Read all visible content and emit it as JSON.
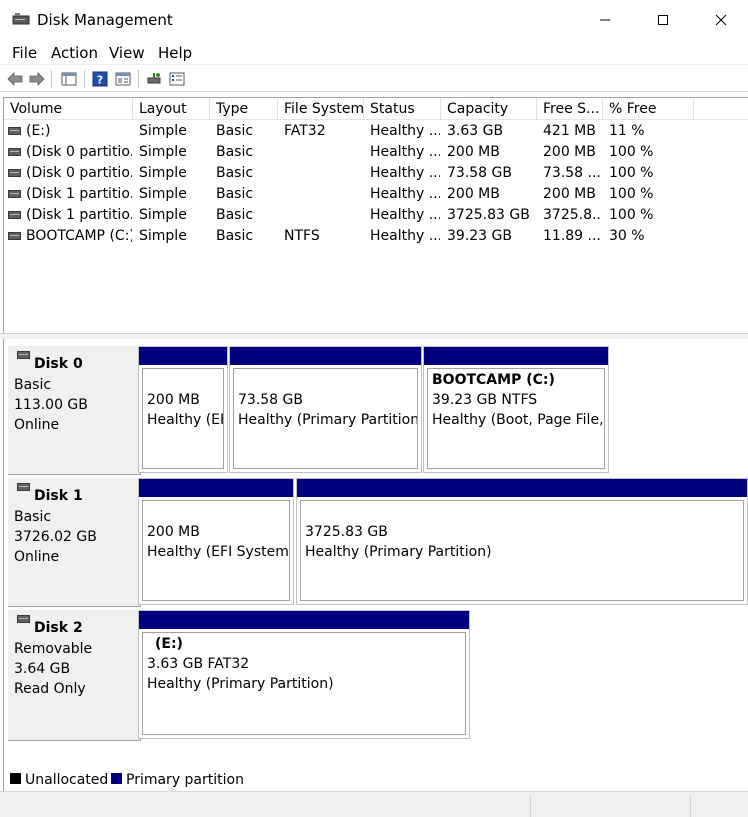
{
  "window": {
    "title": "Disk Management"
  },
  "menu": {
    "file": "File",
    "action": "Action",
    "view": "View",
    "help": "Help"
  },
  "columns": [
    "Volume",
    "Layout",
    "Type",
    "File System",
    "Status",
    "Capacity",
    "Free S...",
    "% Free"
  ],
  "volumes": [
    {
      "volume": "(E:)",
      "layout": "Simple",
      "type": "Basic",
      "fs": "FAT32",
      "status": "Healthy ...",
      "capacity": "3.63 GB",
      "free": "421 MB",
      "pct": "11 %"
    },
    {
      "volume": "(Disk 0 partitio...",
      "layout": "Simple",
      "type": "Basic",
      "fs": "",
      "status": "Healthy ...",
      "capacity": "200 MB",
      "free": "200 MB",
      "pct": "100 %"
    },
    {
      "volume": "(Disk 0 partitio...",
      "layout": "Simple",
      "type": "Basic",
      "fs": "",
      "status": "Healthy ...",
      "capacity": "73.58 GB",
      "free": "73.58 ...",
      "pct": "100 %"
    },
    {
      "volume": "(Disk 1 partitio...",
      "layout": "Simple",
      "type": "Basic",
      "fs": "",
      "status": "Healthy ...",
      "capacity": "200 MB",
      "free": "200 MB",
      "pct": "100 %"
    },
    {
      "volume": "(Disk 1 partitio...",
      "layout": "Simple",
      "type": "Basic",
      "fs": "",
      "status": "Healthy ...",
      "capacity": "3725.83 GB",
      "free": "3725.8...",
      "pct": "100 %"
    },
    {
      "volume": "BOOTCAMP (C:)",
      "layout": "Simple",
      "type": "Basic",
      "fs": "NTFS",
      "status": "Healthy ...",
      "capacity": "39.23 GB",
      "free": "11.89 ...",
      "pct": "30 %"
    }
  ],
  "disks": [
    {
      "name": "Disk 0",
      "kind": "Basic",
      "size": "113.00 GB",
      "state": "Online",
      "partitions": [
        {
          "title": "",
          "line1": "200 MB",
          "line2": "Healthy (EFI System Partition)"
        },
        {
          "title": "",
          "line1": "73.58 GB",
          "line2": "Healthy (Primary Partition)"
        },
        {
          "title": "BOOTCAMP  (C:)",
          "line1": "39.23 GB NTFS",
          "line2": "Healthy (Boot, Page File, Crash Dump, Primary Partition)"
        }
      ]
    },
    {
      "name": "Disk 1",
      "kind": "Basic",
      "size": "3726.02 GB",
      "state": "Online",
      "partitions": [
        {
          "title": "",
          "line1": "200 MB",
          "line2": "Healthy (EFI System Partition)"
        },
        {
          "title": "",
          "line1": "3725.83 GB",
          "line2": "Healthy (Primary Partition)"
        }
      ]
    },
    {
      "name": "Disk 2",
      "kind": "Removable",
      "size": "3.64 GB",
      "state": "Read Only",
      "partitions": [
        {
          "title": "(E:)",
          "line1": "3.63 GB FAT32",
          "line2": "Healthy (Primary Partition)"
        }
      ]
    }
  ],
  "legend": {
    "unallocated": "Unallocated",
    "unallocated_color": "#000000",
    "primary": "Primary partition",
    "primary_color": "#00007f"
  },
  "icons": [
    "disk-management-icon",
    "back-arrow-icon",
    "forward-arrow-icon",
    "console-tree-icon",
    "help-icon",
    "properties-icon",
    "connect-icon",
    "list-view-icon"
  ]
}
